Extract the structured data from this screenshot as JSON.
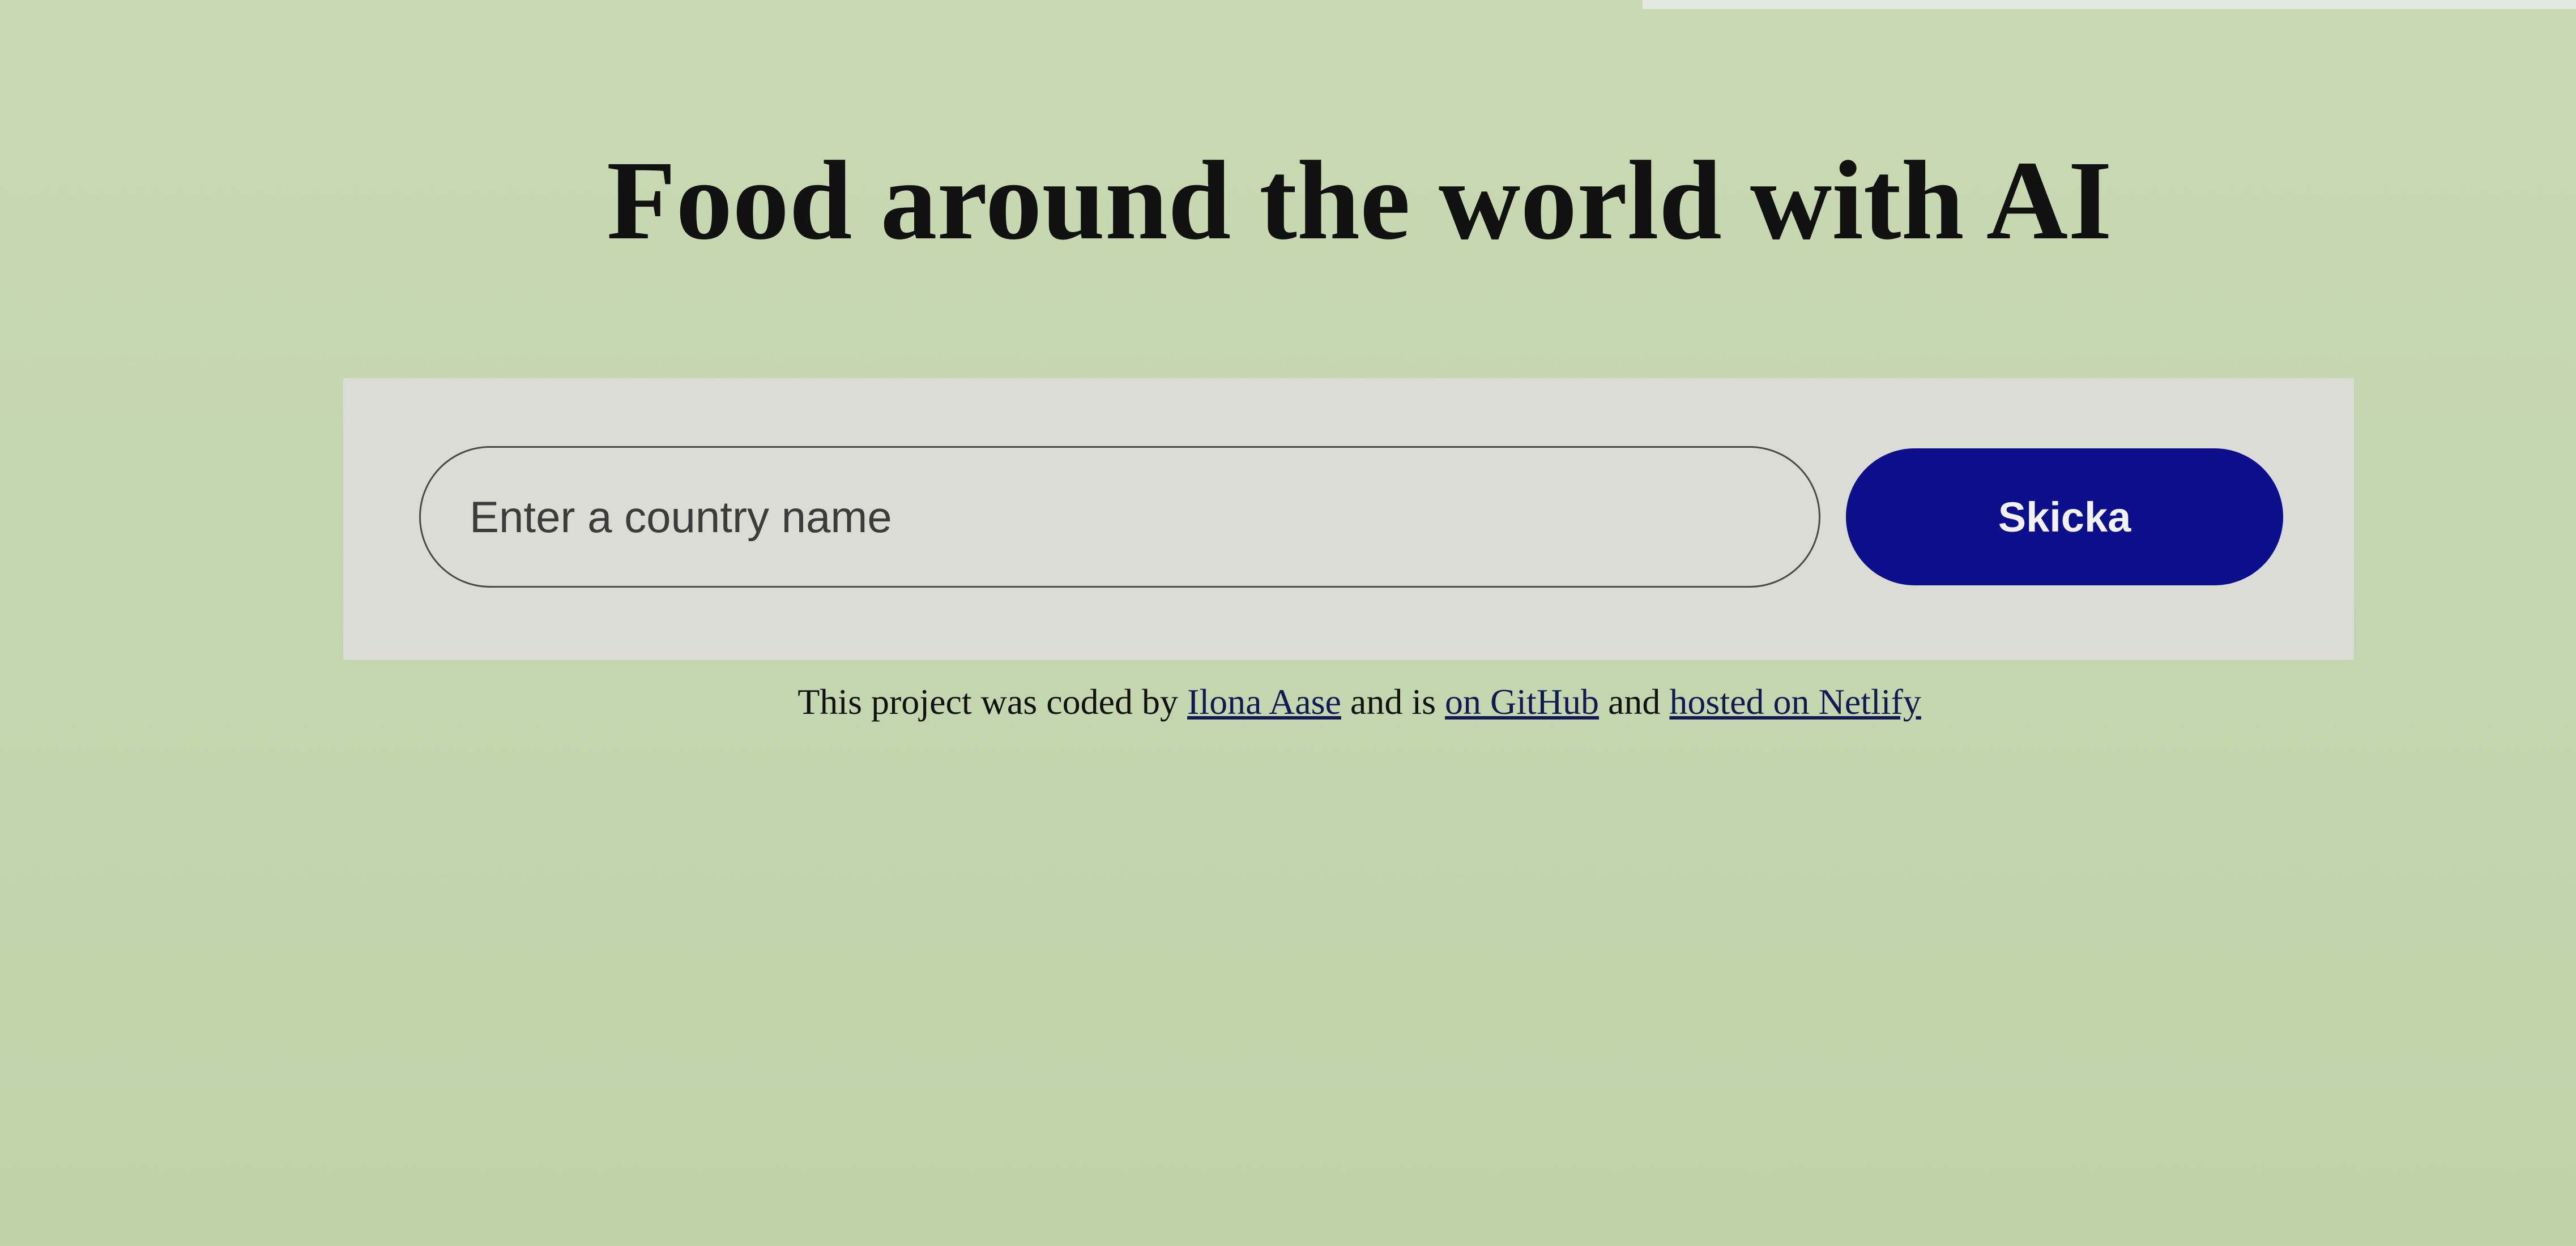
{
  "header": {
    "title": "Food around the world with AI"
  },
  "search": {
    "placeholder": "Enter a country name",
    "value": "",
    "submit_label": "Skicka"
  },
  "footer": {
    "prefix": "This project was coded by",
    "author_link": "Ilona Aase",
    "middle": "and is",
    "github_link": "on GitHub",
    "connector": "and",
    "netlify_link": "hosted on Netlify"
  },
  "colors": {
    "background": "#c6d8ae",
    "panel": "#dcdcd6",
    "button": "#0c0f8c",
    "button_text": "#f2f2f2"
  }
}
